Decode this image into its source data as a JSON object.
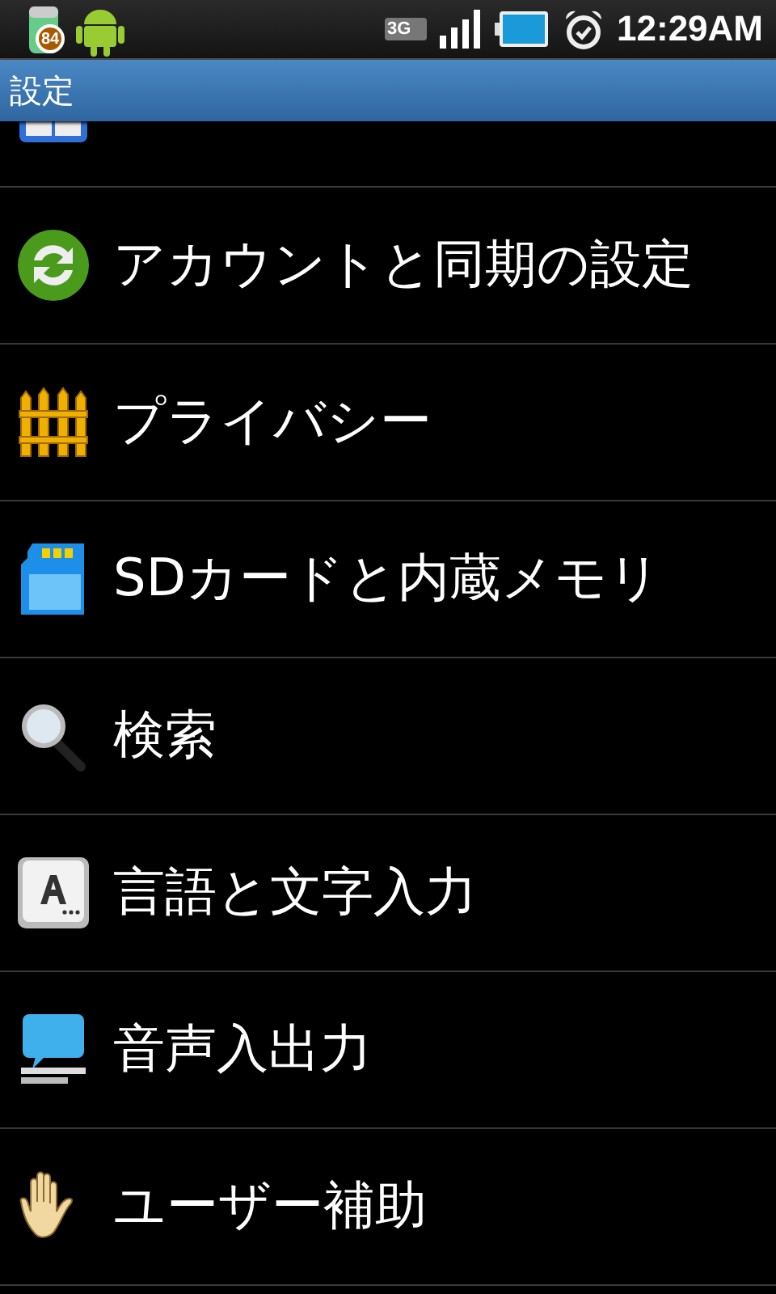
{
  "status_bar": {
    "badge": "84",
    "network": "3G",
    "time": "12:29AM"
  },
  "title_bar": {
    "title": "設定"
  },
  "settings": [
    {
      "kind": "apps"
    },
    {
      "kind": "sync",
      "label": "アカウントと同期の設定"
    },
    {
      "kind": "fence",
      "label": "プライバシー"
    },
    {
      "kind": "sdcard",
      "label": "SDカードと内蔵メモリ"
    },
    {
      "kind": "search",
      "label": "検索"
    },
    {
      "kind": "keyboard",
      "label": "言語と文字入力"
    },
    {
      "kind": "speech",
      "label": "音声入出力"
    },
    {
      "kind": "hand",
      "label": "ユーザー補助"
    }
  ]
}
